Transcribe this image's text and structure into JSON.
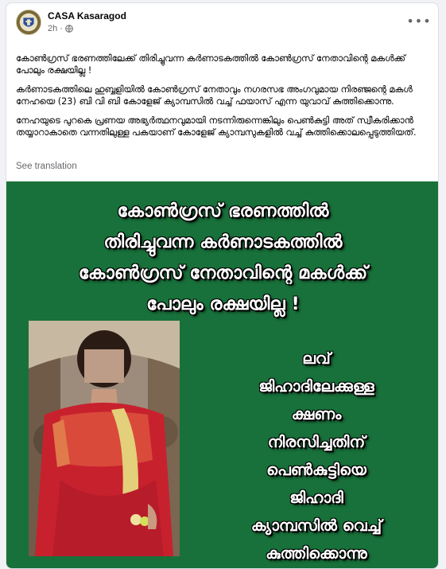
{
  "post": {
    "page_name": "CASA Kasaragod",
    "timestamp": "2h",
    "privacy_icon": "globe-icon",
    "more_icon": "more-options-icon",
    "more_label": "•••",
    "paragraphs": [
      "കോൺഗ്രസ് ഭരണത്തിലേക്ക് തിരിച്ചുവന്ന കർണാടകത്തിൽ കോൺഗ്രസ് നേതാവിന്റെ മകൾക്ക് പോലും രക്ഷയില്ല !",
      "കർണാടകത്തിലെ ഹുബ്ബളിയിൽ കോൺഗ്രസ് നേതാവും നഗരസഭ അംഗവുമായ നിരഞ്ജന്റെ മകൾ നേഹയെ (23) ബി വി ബി കോളേജ് ക്യാമ്പസിൽ വച്ച് ഫയാസ് എന്ന യുവാവ് കുത്തിക്കൊന്നു.",
      "നേഹയുടെ പുറകെ പ്രണയ അഭ്യർത്ഥനവുമായി നടന്നിരുന്നെങ്കിലും പെൺകുട്ടി അത് സ്വീകരിക്കാൻ തയ്യാറാകാതെ വന്നതിലുള്ള പകയാണ് കോളേജ് ക്യാമ്പസുകളിൽ വച്ച് കുത്തിക്കൊലപ്പെടുത്തിയത്."
    ],
    "see_translation": "See translation"
  },
  "image": {
    "background_color": "#18713a",
    "headline_lines": [
      "കോൺഗ്രസ് ഭരണത്തിൽ",
      "തിരിച്ചുവന്ന കർണാടകത്തിൽ",
      "കോൺഗ്രസ് നേതാവിന്റെ മകൾക്ക്",
      "പോലും രക്ഷയില്ല !"
    ],
    "side_lines": [
      "ലവ്",
      "ജിഹാദിലേക്കുള്ള",
      "ക്ഷണം",
      "നിരസിച്ചതിന്",
      "പെൺകുട്ടിയെ",
      "ജിഹാദി",
      "ക്യാമ്പസിൽ വെച്ച്",
      "കുത്തിക്കൊന്നു"
    ]
  }
}
